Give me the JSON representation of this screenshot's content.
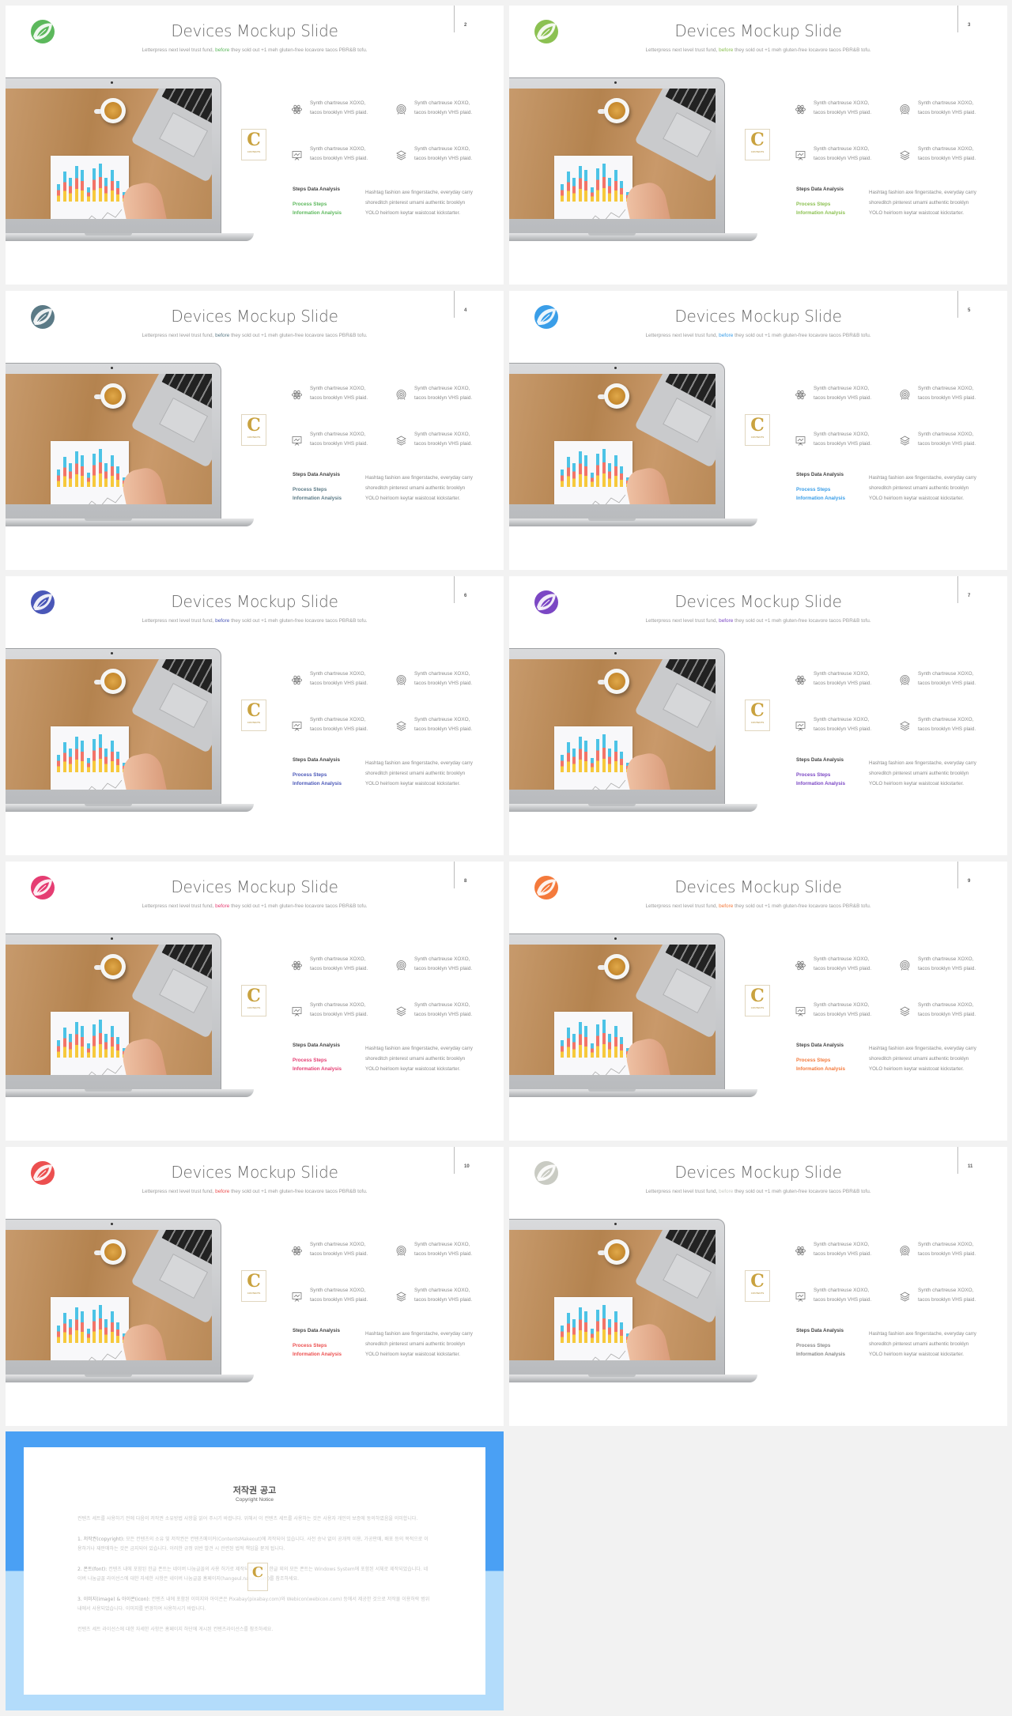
{
  "slide_content": {
    "title": "Devices Mockup Slide",
    "subtitle_before": "Letterpress next level trust fund, ",
    "subtitle_highlight": "before",
    "subtitle_after": " they sold out +1 meh gluten-free locavore tacos PBR&B tofu.",
    "features": [
      {
        "icon": "atom-icon",
        "line1": "Synth chartreuse XOXO,",
        "line2": "tacos brooklyn VHS plaid."
      },
      {
        "icon": "target-icon",
        "line1": "Synth chartreuse XOXO,",
        "line2": "tacos brooklyn VHS plaid."
      },
      {
        "icon": "presentation-board-icon",
        "line1": "Synth chartreuse XOXO,",
        "line2": "tacos brooklyn VHS plaid."
      },
      {
        "icon": "layers-icon",
        "line1": "Synth chartreuse XOXO,",
        "line2": "tacos brooklyn VHS plaid."
      }
    ],
    "steps_heading": "Steps Data Analysis",
    "process_steps": "Process Steps",
    "information_analysis": "Information Analysis",
    "paragraph": [
      "Hashtag fashion axe fingerstache, everyday carry",
      "shoreditch pinterest umami authentic brooklyn",
      "YOLO heirloom keytar waistcoat kickstarter."
    ],
    "badge_letter": "C",
    "badge_text": "CONTENTS"
  },
  "slides": [
    {
      "page": "2",
      "accent": "#5cb85c"
    },
    {
      "page": "3",
      "accent": "#8cc152"
    },
    {
      "page": "4",
      "accent": "#5b7a86"
    },
    {
      "page": "5",
      "accent": "#3a9ee8"
    },
    {
      "page": "6",
      "accent": "#4a57b8"
    },
    {
      "page": "7",
      "accent": "#7b47c4"
    },
    {
      "page": "8",
      "accent": "#e53d72"
    },
    {
      "page": "9",
      "accent": "#f47a3c"
    },
    {
      "page": "10",
      "accent": "#ec4f4f"
    },
    {
      "page": "11",
      "accent": "#c9cbc3"
    }
  ],
  "copyright": {
    "title": "저작권 공고",
    "subtitle": "Copyright Notice",
    "intro": "컨텐츠 세트를 사용하기 전에 다음의 저작권 소유방법 사항을 읽어 주시기 바랍니다. 위해서 이 컨텐츠 세트를 사용하는 것은 사용자 개인의 보증에 동의하였음을 의미합니다.",
    "items": [
      {
        "label": "1. 저작권(copyright):",
        "text": " 모든 컨텐츠의 소유 및 저작권은 컨텐츠메이커(ContentsMakeout)에 저작되어 있습니다. 사전 승낙 없이 공개적 이용, 가공판매, 배포 등의 목적으로 이용하거나 재판매하는 것은 금지되어 있습니다. 이러한 규정 위반 발견 시 관련된 법적 책임을 묻게 됩니다."
      },
      {
        "label": "2. 폰트(font):",
        "text": " 컨텐츠 내에 포함된 한글 폰트는 네이버 나눔글꼴의 사용 허가로 제작되었습니다. 한글 외의 모든 폰트는 Windows System에 포함된 서체로 제작되었습니다. 네이버 나눔글꼴 라이선스에 대한 자세한 사항은 네이버 나눔글꼴 홈페이지(hangeul.naver.com)를 참조하세요."
      },
      {
        "label": "3. 이미지(image) & 아이콘(icon):",
        "text": " 컨텐츠 내에 포함된 이미지와 아이콘은 Pixabay(pixabay.com)와 Webicon(webicon.com) 등에서 제공한 것으로 저작물 이용허락 범위 내에서 사용되었습니다. 이미지를 변경하여 사용하시기 바랍니다."
      }
    ],
    "closing": "컨텐츠 세트 라이선스에 대한 자세한 사항은 홈페이지 하단에 게시된 컨텐츠라이선스를 참조하세요.",
    "badge_letter": "C"
  }
}
